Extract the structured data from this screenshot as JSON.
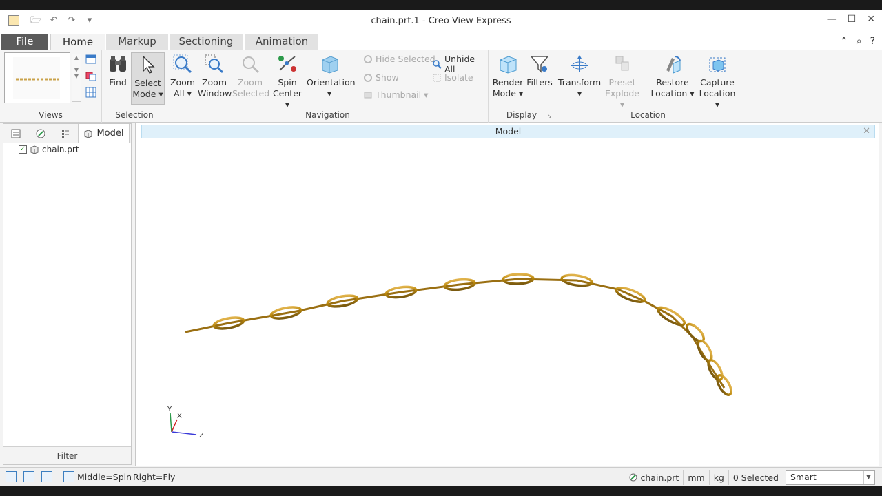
{
  "window": {
    "title": "chain.prt.1 - Creo View Express",
    "minimize": "—",
    "maximize": "☐",
    "close": "✕"
  },
  "tabs": {
    "file": "File",
    "home": "Home",
    "markup": "Markup",
    "sectioning": "Sectioning",
    "animation": "Animation"
  },
  "ribbon": {
    "groups": {
      "views": "Views",
      "selection": "Selection",
      "navigation": "Navigation",
      "display": "Display",
      "location": "Location"
    },
    "find": "Find",
    "select_mode_1": "Select",
    "select_mode_2": "Mode ▾",
    "zoom_all_1": "Zoom",
    "zoom_all_2": "All ▾",
    "zoom_window_1": "Zoom",
    "zoom_window_2": "Window",
    "zoom_selected_1": "Zoom",
    "zoom_selected_2": "Selected",
    "spin_center_1": "Spin",
    "spin_center_2": "Center ▾",
    "orientation_1": "Orientation",
    "orientation_2": "▾",
    "hide_selected": "Hide Selected",
    "unhide_all": "Unhide All",
    "show": "Show",
    "isolate": "Isolate",
    "thumbnail": "Thumbnail ▾",
    "render_mode_1": "Render",
    "render_mode_2": "Mode ▾",
    "filters": "Filters",
    "transform_1": "Transform",
    "transform_2": "▾",
    "preset_explode_1": "Preset",
    "preset_explode_2": "Explode ▾",
    "restore_location_1": "Restore",
    "restore_location_2": "Location ▾",
    "capture_location_1": "Capture",
    "capture_location_2": "Location ▾"
  },
  "left_panel": {
    "model_tab": "Model",
    "tree_item": "chain.prt",
    "filter": "Filter"
  },
  "viewport": {
    "header": "Model",
    "axis_x": "X",
    "axis_y": "Y",
    "axis_z": "Z"
  },
  "status": {
    "middle": "Middle=Spin",
    "right": "Right=Fly",
    "model": "chain.prt",
    "unit_length": "mm",
    "unit_mass": "kg",
    "selected": "0 Selected",
    "filter_mode": "Smart"
  },
  "colors": {
    "chain": "#b8860b",
    "viewport_header": "#dff0fa",
    "file_tab": "#5b5b5b"
  }
}
